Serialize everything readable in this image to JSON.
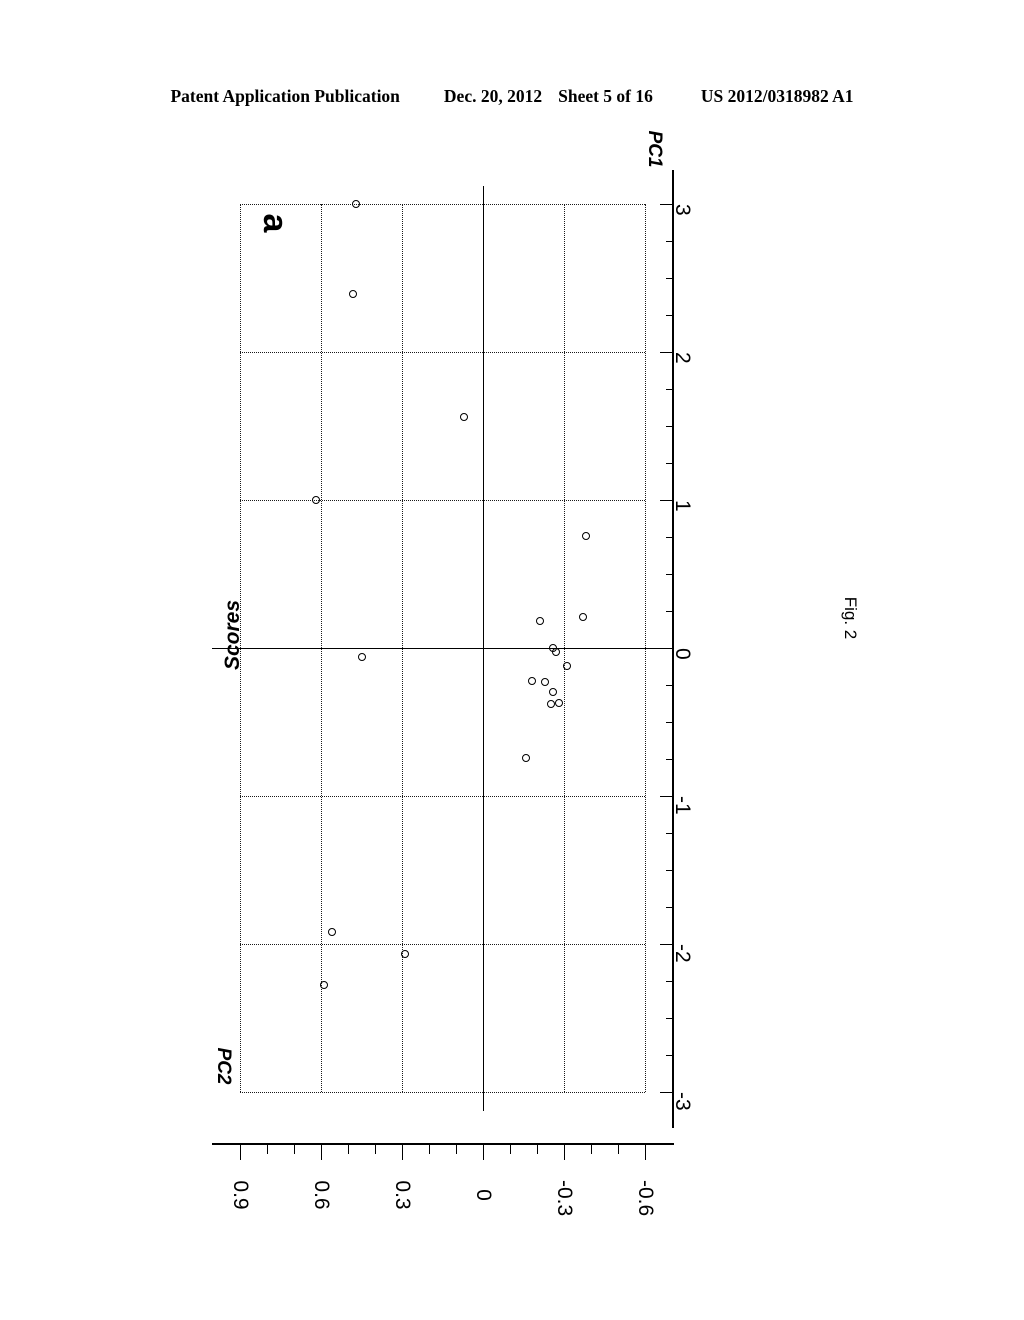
{
  "header": {
    "publication": "Patent Application Publication",
    "date": "Dec. 20, 2012",
    "sheet": "Sheet 5 of 16",
    "patent_number": "US 2012/0318982 A1"
  },
  "figure": {
    "caption": "Fig. 2",
    "panel_label": "a"
  },
  "chart_data": {
    "type": "scatter",
    "title": "Scores",
    "xlabel": "PC2",
    "ylabel": "PC1",
    "orientation": "rotated-90",
    "grid": true,
    "legend": null,
    "xlim": [
      0.9,
      -0.6
    ],
    "ylim": [
      -3,
      3
    ],
    "xticks": [
      0.9,
      0.6,
      0.3,
      0,
      -0.3,
      -0.6
    ],
    "xtick_labels": [
      "0.9",
      "0.6",
      "0.3",
      "0",
      "-0.3",
      "-0.6"
    ],
    "yticks": [
      3,
      2,
      1,
      0,
      -1,
      -2,
      -3
    ],
    "ytick_labels": [
      "3",
      "2",
      "1",
      "0",
      "-1",
      "-2",
      "-3"
    ],
    "xminor_step": 0.1,
    "yminor_step": 0.25,
    "marker": "open-circle",
    "points": [
      {
        "pc1": 3.0,
        "pc2": 0.47
      },
      {
        "pc1": 2.39,
        "pc2": 0.48
      },
      {
        "pc1": 1.56,
        "pc2": 0.07
      },
      {
        "pc1": 1.0,
        "pc2": 0.62
      },
      {
        "pc1": 0.76,
        "pc2": -0.38
      },
      {
        "pc1": 0.21,
        "pc2": -0.37
      },
      {
        "pc1": 0.18,
        "pc2": -0.21
      },
      {
        "pc1": 0.0,
        "pc2": -0.26
      },
      {
        "pc1": -0.03,
        "pc2": -0.27
      },
      {
        "pc1": -0.06,
        "pc2": 0.45
      },
      {
        "pc1": -0.12,
        "pc2": -0.31
      },
      {
        "pc1": -0.22,
        "pc2": -0.18
      },
      {
        "pc1": -0.23,
        "pc2": -0.23
      },
      {
        "pc1": -0.3,
        "pc2": -0.26
      },
      {
        "pc1": -0.37,
        "pc2": -0.28
      },
      {
        "pc1": -0.38,
        "pc2": -0.25
      },
      {
        "pc1": -0.74,
        "pc2": -0.16
      },
      {
        "pc1": -1.92,
        "pc2": 0.56
      },
      {
        "pc1": -2.07,
        "pc2": 0.29
      },
      {
        "pc1": -2.28,
        "pc2": 0.59
      }
    ]
  }
}
